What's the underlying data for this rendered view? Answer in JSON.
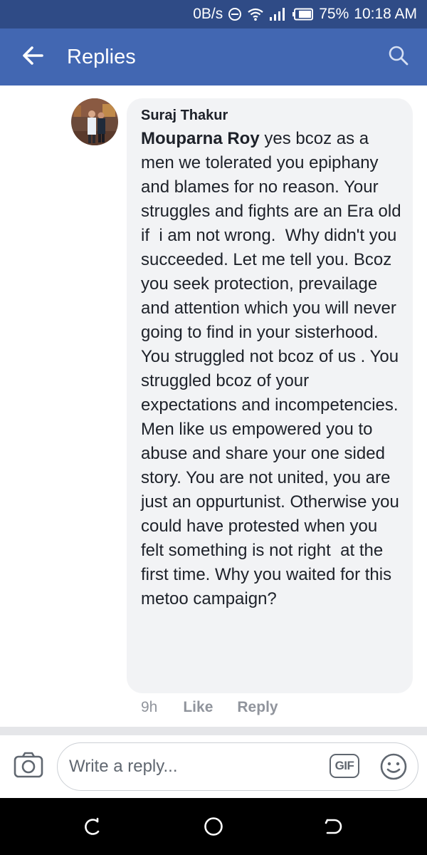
{
  "status_bar": {
    "net_speed": "0B/s",
    "battery_percent": "75%",
    "time": "10:18 AM",
    "icons": [
      "dnd-icon",
      "wifi-icon",
      "signal-icon",
      "battery-icon"
    ]
  },
  "app_bar": {
    "title": "Replies",
    "background_color": "#4267b2",
    "back_icon": "arrow-left-icon",
    "search_icon": "search-icon"
  },
  "comment": {
    "author": "Suraj Thakur",
    "mention": "Mouparna Roy",
    "text": " yes bcoz as a men we tolerated you epiphany and blames for no reason. Your struggles and fights are an Era old if  i am not wrong.  Why didn't you succeeded. Let me tell you. Bcoz you seek protection, prevailage and attention which you will never going to find in your sisterhood. You struggled not bcoz of us . You struggled bcoz of your expectations and incompetencies. Men like us empowered you to abuse and share your one sided story. You are not united, you are just an oppurtunist. Otherwise you could have protested when you felt something is not right  at the first time. Why you waited for this metoo campaign?",
    "time_ago": "9h",
    "like_label": "Like",
    "reply_label": "Reply"
  },
  "composer": {
    "placeholder": "Write a reply...",
    "gif_label": "GIF",
    "icons": [
      "camera-icon",
      "gif-icon",
      "emoji-icon"
    ]
  },
  "nav_bar": {
    "icons": [
      "recent-apps-icon",
      "home-icon",
      "back-icon"
    ]
  }
}
